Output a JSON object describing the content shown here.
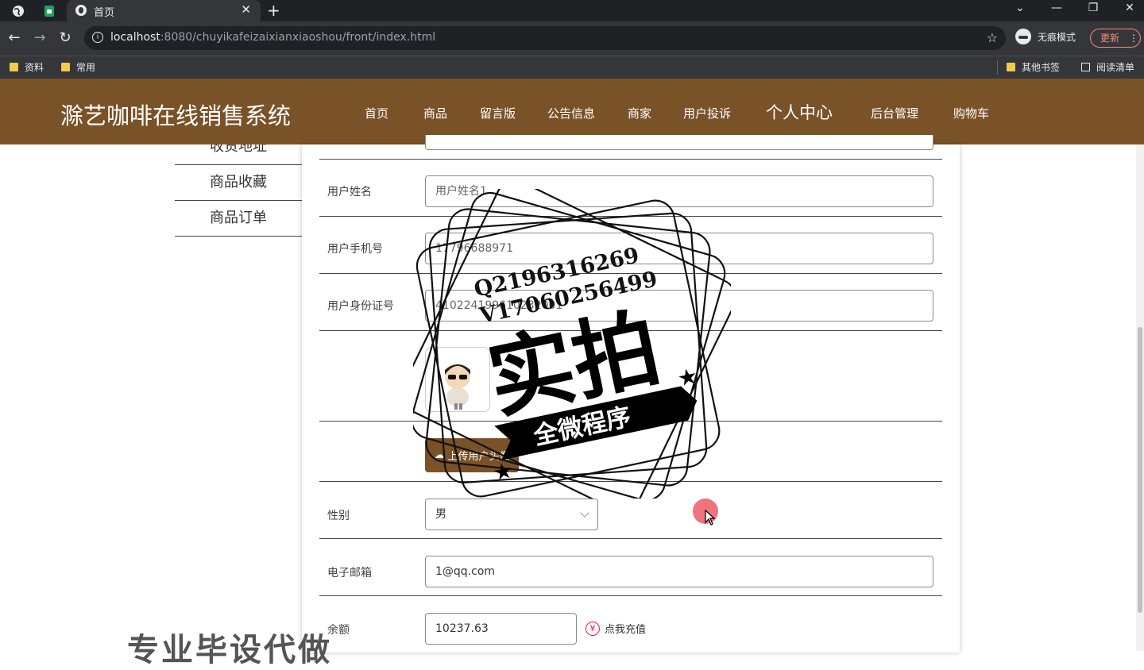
{
  "browser": {
    "tab_title": "首页",
    "url_host": "localhost",
    "url_rest": ":8080/chuyikafeizaixianxiaoshou/front/index.html",
    "incognito_label": "无痕模式",
    "update_label": "更新",
    "bookmarks": [
      "资料",
      "常用"
    ],
    "other_bookmarks": "其他书签",
    "reading_list": "阅读清单"
  },
  "site": {
    "title": "滁艺咖啡在线销售系统",
    "nav": [
      "首页",
      "商品",
      "留言版",
      "公告信息",
      "商家",
      "用户投诉",
      "个人中心",
      "后台管理",
      "购物车"
    ],
    "active_nav": "个人中心"
  },
  "sidebar": {
    "items": [
      "收货地址",
      "商品收藏",
      "商品订单"
    ]
  },
  "form": {
    "name_label": "用户姓名",
    "name_value": "用户姓名1",
    "phone_label": "用户手机号",
    "phone_value": "17796688971",
    "idcard_label": "用户身份证号",
    "idcard_value": "410224199610232001",
    "upload_label": "上传用户头像",
    "gender_label": "性别",
    "gender_value": "男",
    "email_label": "电子邮箱",
    "email_value": "1@qq.com",
    "balance_label": "余额",
    "balance_value": "10237.63",
    "recharge_label": "点我充值"
  },
  "watermark": {
    "qq": "Q2196316269",
    "wechat": "V17060256499",
    "big": "实拍",
    "banner": "全微程序",
    "bottom": "专业毕设代做"
  },
  "colors": {
    "header_brown": "#7a5228",
    "chrome_dark": "#202124",
    "chrome_mid": "#35363a"
  }
}
